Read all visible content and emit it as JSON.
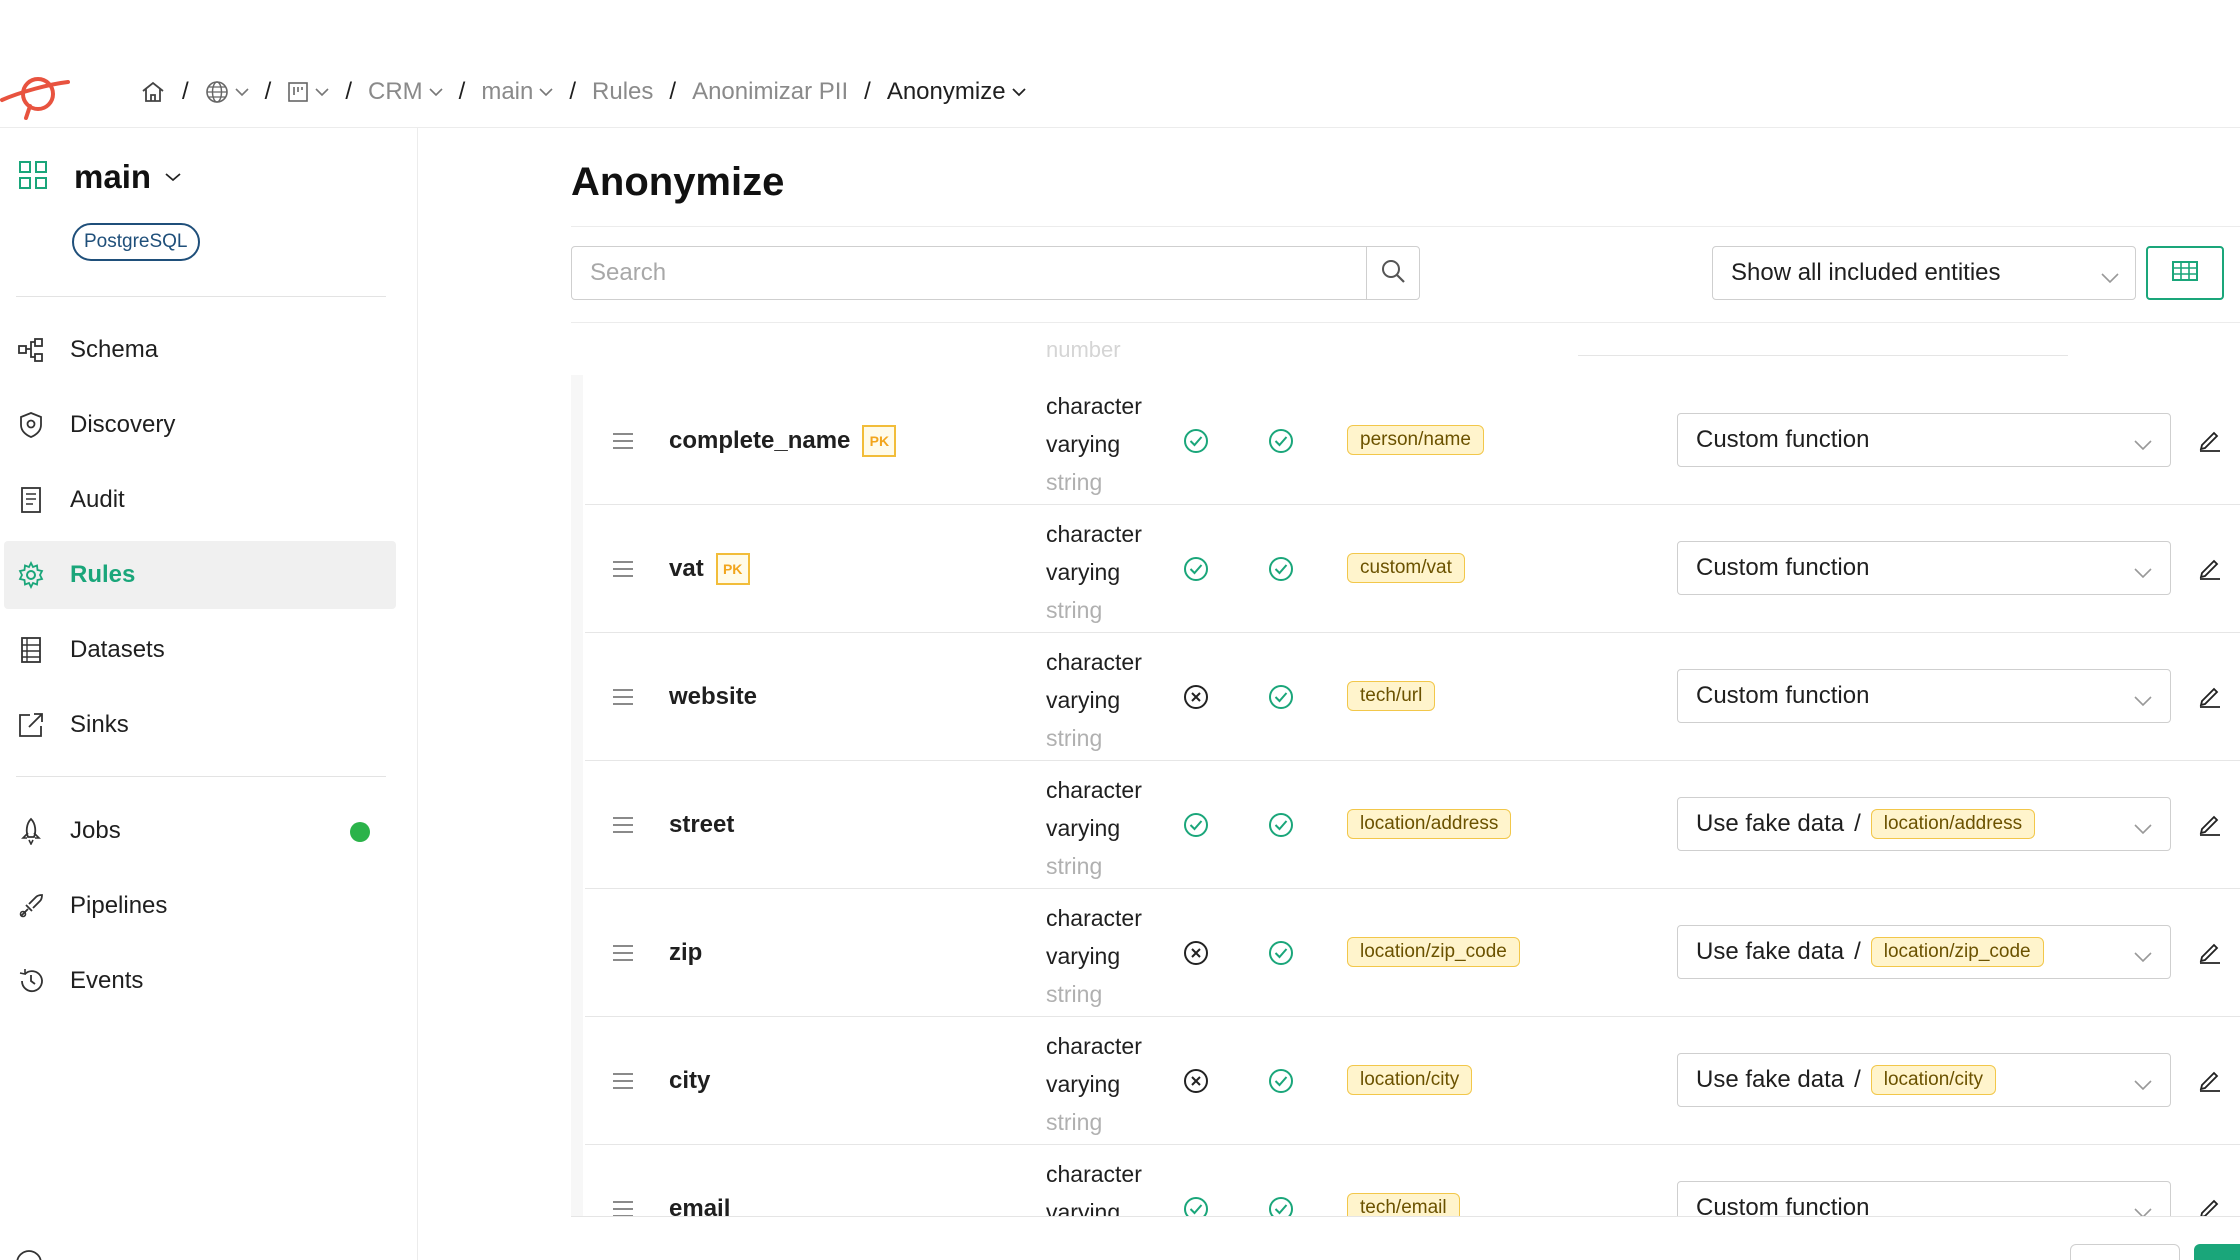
{
  "breadcrumb": {
    "items": [
      {
        "label": "CRM"
      },
      {
        "label": "main"
      },
      {
        "label": "Rules"
      },
      {
        "label": "Anonimizar PII"
      },
      {
        "label": "Anonymize"
      }
    ]
  },
  "sidebar": {
    "workspace_name": "main",
    "db_badge": "PostgreSQL",
    "items": [
      {
        "label": "Schema",
        "icon": "schema-icon"
      },
      {
        "label": "Discovery",
        "icon": "shield-icon"
      },
      {
        "label": "Audit",
        "icon": "audit-icon"
      },
      {
        "label": "Rules",
        "icon": "gear-icon",
        "active": true
      },
      {
        "label": "Datasets",
        "icon": "datasets-icon"
      },
      {
        "label": "Sinks",
        "icon": "export-icon"
      },
      {
        "label": "Jobs",
        "icon": "rocket-icon",
        "status_color": "#2bb34a"
      },
      {
        "label": "Pipelines",
        "icon": "pipeline-icon"
      },
      {
        "label": "Events",
        "icon": "history-icon"
      }
    ]
  },
  "main": {
    "title": "Anonymize",
    "search_placeholder": "Search",
    "filter_value": "Show all included entities",
    "ghost_text": "number",
    "rows": [
      {
        "name": "complete_name",
        "pk": "PK",
        "type_line1": "character",
        "type_line2": "varying",
        "type_sub": "string",
        "flag1": "check",
        "flag2": "check",
        "classification": "person/name",
        "method": "Custom function",
        "method_tag": ""
      },
      {
        "name": "vat",
        "pk": "PK",
        "type_line1": "character",
        "type_line2": "varying",
        "type_sub": "string",
        "flag1": "check",
        "flag2": "check",
        "classification": "custom/vat",
        "method": "Custom function",
        "method_tag": ""
      },
      {
        "name": "website",
        "pk": "",
        "type_line1": "character",
        "type_line2": "varying",
        "type_sub": "string",
        "flag1": "cross",
        "flag2": "check",
        "classification": "tech/url",
        "method": "Custom function",
        "method_tag": ""
      },
      {
        "name": "street",
        "pk": "",
        "type_line1": "character",
        "type_line2": "varying",
        "type_sub": "string",
        "flag1": "check",
        "flag2": "check",
        "classification": "location/address",
        "method": "Use fake data",
        "method_tag": "location/address"
      },
      {
        "name": "zip",
        "pk": "",
        "type_line1": "character",
        "type_line2": "varying",
        "type_sub": "string",
        "flag1": "cross",
        "flag2": "check",
        "classification": "location/zip_code",
        "method": "Use fake data",
        "method_tag": "location/zip_code"
      },
      {
        "name": "city",
        "pk": "",
        "type_line1": "character",
        "type_line2": "varying",
        "type_sub": "string",
        "flag1": "cross",
        "flag2": "check",
        "classification": "location/city",
        "method": "Use fake data",
        "method_tag": "location/city"
      },
      {
        "name": "email",
        "pk": "",
        "type_line1": "character",
        "type_line2": "varying",
        "type_sub": "",
        "flag1": "check",
        "flag2": "check",
        "classification": "tech/email",
        "method": "Custom function",
        "method_tag": ""
      }
    ]
  },
  "colors": {
    "accent": "#1aa67a",
    "tag_bg": "#fff4cc",
    "tag_border": "#f2c74a",
    "logo": "#e8533f",
    "jobs_status": "#2bb34a"
  }
}
